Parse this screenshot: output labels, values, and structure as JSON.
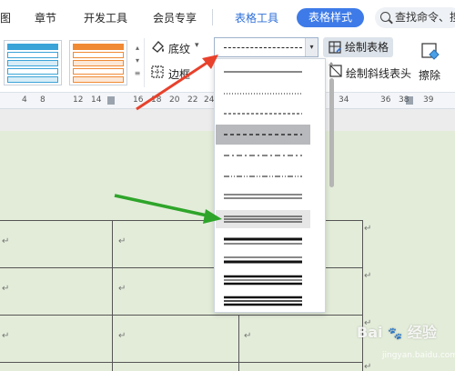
{
  "menubar": {
    "tabs": [
      "图",
      "章节",
      "开发工具",
      "会员专享",
      "表格工具"
    ],
    "active_tab": "表格样式",
    "search_text": "查找命令、搜"
  },
  "ribbon": {
    "shading_label": "底纹",
    "border_label": "边框",
    "draw_table_label": "绘制表格",
    "draw_diagonal_label": "绘制斜线表头",
    "erase_label": "擦除",
    "gallery_colors": [
      "#3aa3d8",
      "#f08a35"
    ]
  },
  "ruler": {
    "numbers": [
      "4",
      "8",
      "12",
      "14",
      "16",
      "18",
      "20",
      "22",
      "24",
      "34",
      "36",
      "38",
      "39"
    ]
  },
  "dropdown": {
    "options": [
      "solid-thin",
      "dotted-fine",
      "dashed-fine",
      "dashed-medium",
      "dash-dot",
      "dash-dot-dot",
      "double",
      "triple-thin",
      "thick-thin",
      "thin-thick",
      "thick-thin-thick",
      "triple-thick"
    ],
    "highlighted": "dashed-medium",
    "hovered": "triple-thin"
  },
  "paragraph_mark": "↵",
  "watermark": {
    "brand": "Bai",
    "suffix": "经验",
    "sub": "jingyan.baidu.com"
  },
  "colors": {
    "accent": "#3e7be8",
    "doc_background": "#e3ecd9",
    "arrow_red": "#e8412c",
    "arrow_green": "#2ea52a"
  }
}
